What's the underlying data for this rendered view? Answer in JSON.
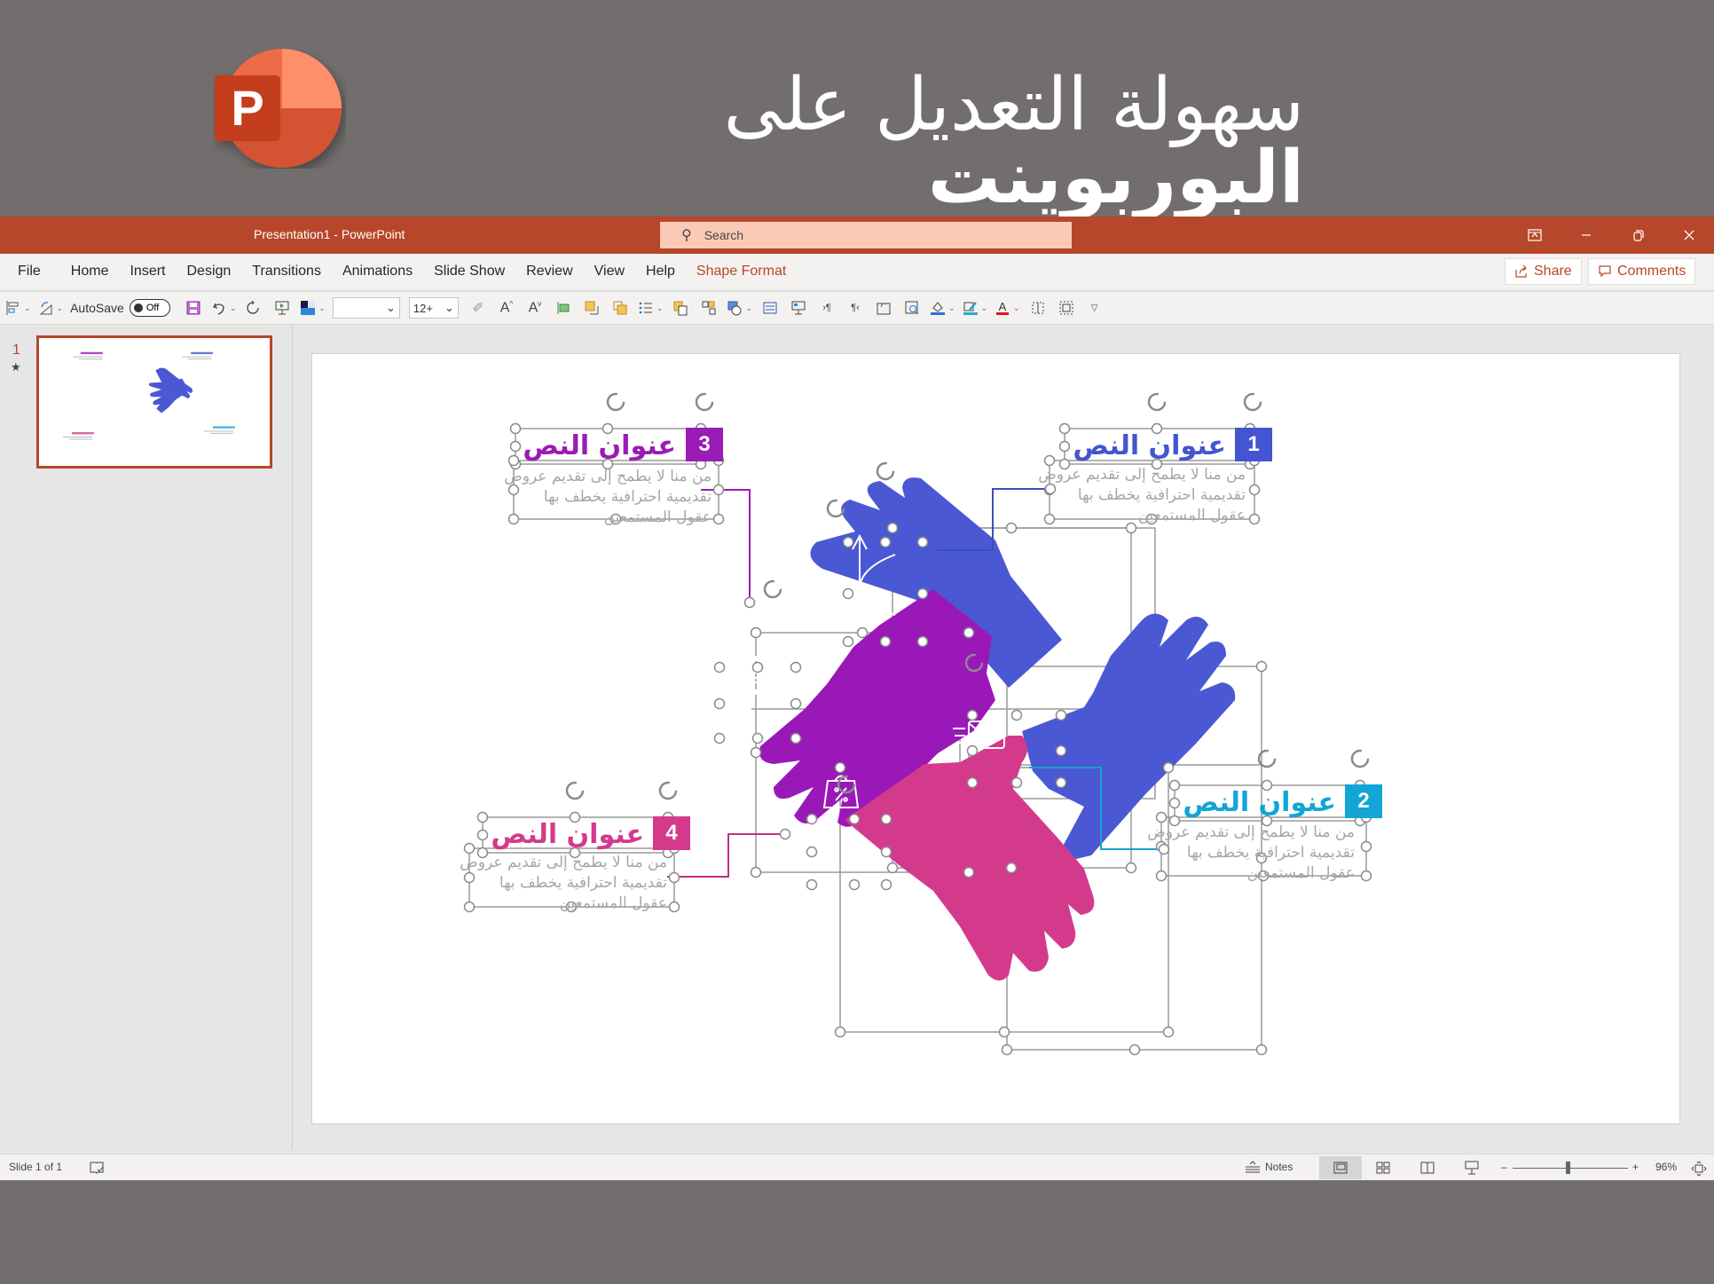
{
  "banner": {
    "title_regular": "سهولة التعديل على",
    "title_bold": "البوربوينت",
    "logo_letter": "P"
  },
  "titlebar": {
    "doc_title": "Presentation1  -  PowerPoint",
    "search_placeholder": "Search",
    "controls": [
      "ribbon-display-icon",
      "minimize-icon",
      "restore-icon",
      "close-icon"
    ]
  },
  "menu": {
    "tabs": [
      "File",
      "Home",
      "Insert",
      "Design",
      "Transitions",
      "Animations",
      "Slide Show",
      "Review",
      "View",
      "Help",
      "Shape Format"
    ],
    "active_tab": "Shape Format",
    "share_label": "Share",
    "comments_label": "Comments"
  },
  "toolbar": {
    "autosave_label": "AutoSave",
    "autosave_state": "Off",
    "font_name_value": "",
    "font_size_value": "12+"
  },
  "thumbnails": [
    {
      "number": "1",
      "starred": true
    }
  ],
  "slide": {
    "callouts": [
      {
        "number": "1",
        "title": "عنوان النص",
        "body_lines": [
          "من منا لا يطمح إلى تقديم عروض",
          "تقديمية احترافية يخطف بها",
          "عقول المستمعين"
        ],
        "color": "#4355d0"
      },
      {
        "number": "2",
        "title": "عنوان النص",
        "body_lines": [
          "من منا لا يطمح إلى تقديم عروض",
          "تقديمية احترافية يخطف بها",
          "عقول المستمعين"
        ],
        "color": "#12a5d6"
      },
      {
        "number": "3",
        "title": "عنوان النص",
        "body_lines": [
          "من منا لا يطمح إلى تقديم عروض",
          "تقديمية احترافية يخطف بها",
          "عقول المستمعين"
        ],
        "color": "#9a1bb5"
      },
      {
        "number": "4",
        "title": "عنوان النص",
        "body_lines": [
          "من منا لا يطمح إلى تقديم عروض",
          "تقديمية احترافية يخطف بها",
          "عقول المستمعين"
        ],
        "color": "#d33a8c"
      }
    ],
    "hand_colors": {
      "blue": "#4a58d4",
      "purple": "#9b18b8",
      "pink": "#d43a8b"
    },
    "hand_icons": [
      "direction-arrows-icon",
      "email-icon",
      "shopping-bag-percent-icon",
      "cpu-chip-icon"
    ]
  },
  "statusbar": {
    "slide_info": "Slide 1 of 1",
    "notes_label": "Notes",
    "zoom_level": "96%",
    "zoom_fraction": 0.48
  }
}
